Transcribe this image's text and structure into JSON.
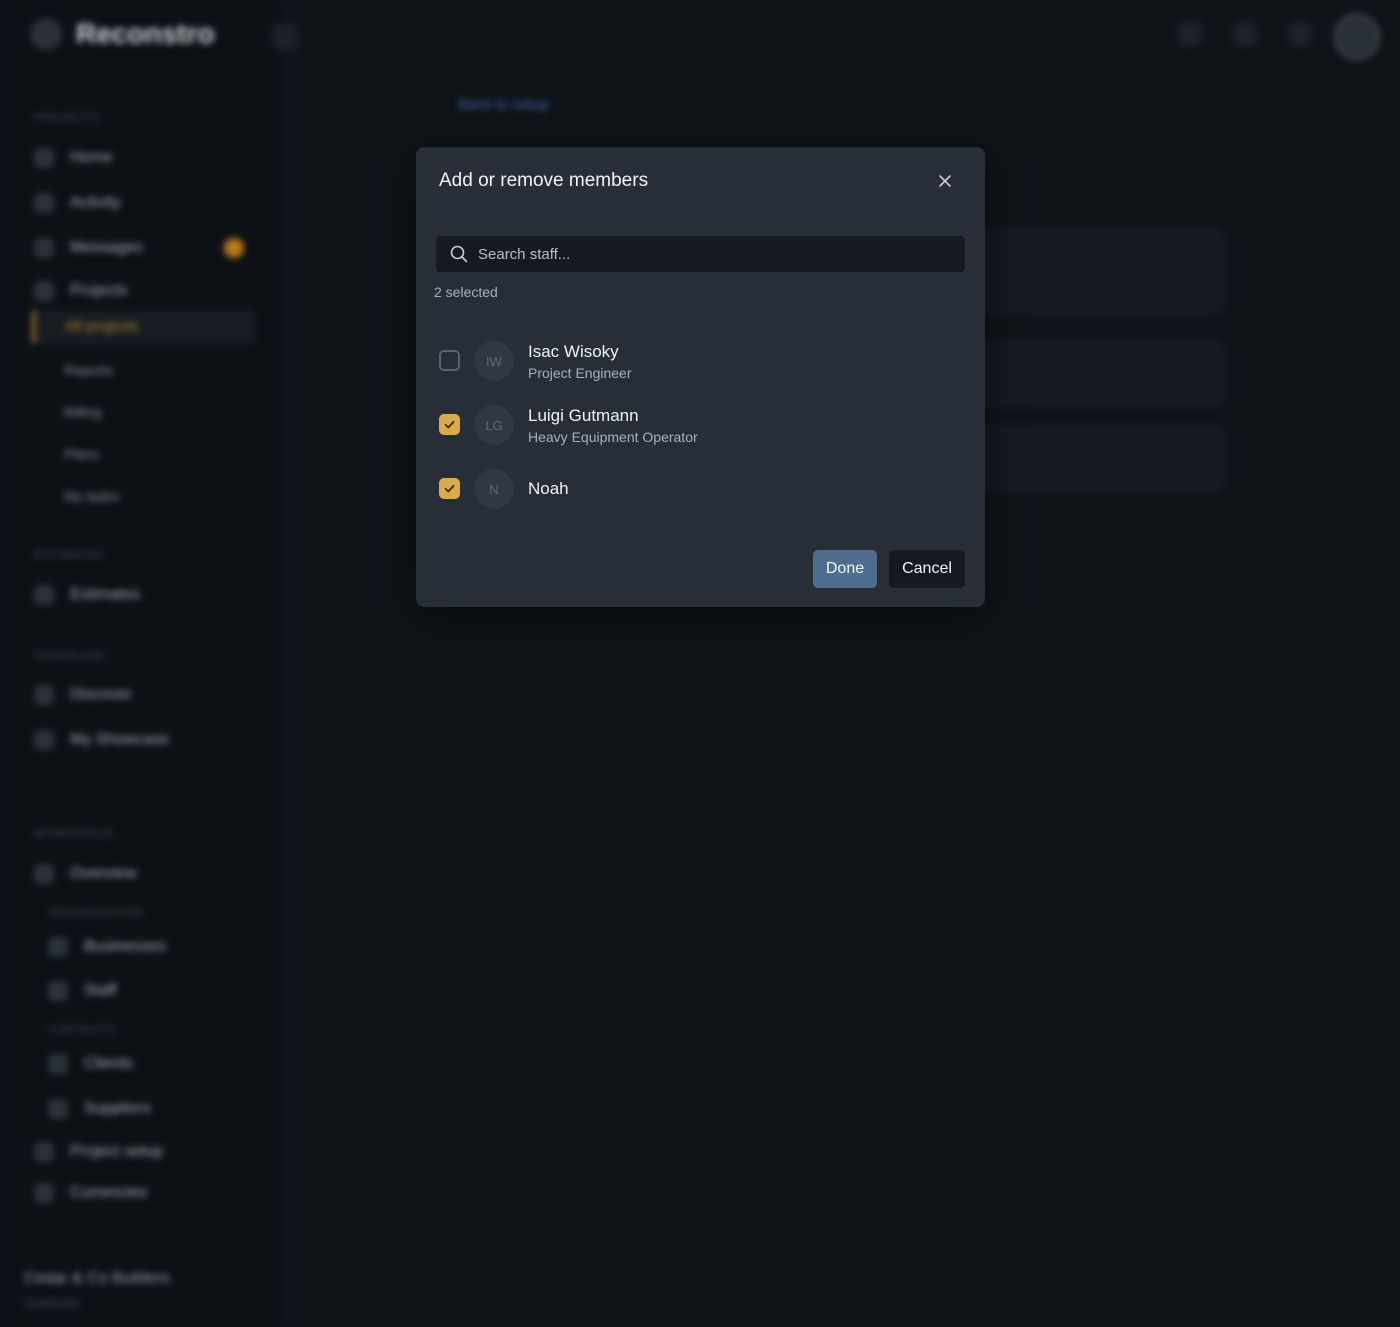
{
  "background": {
    "brand_name": "Reconstro",
    "sections": {
      "projects": "PROJECTS",
      "estimates": "ESTIMATES",
      "showcase": "SHOWCASE",
      "workspace": "WORKSPACE",
      "organization": "ORGANIZATION",
      "contacts": "CONTACTS"
    },
    "nav": {
      "home": "Home",
      "activity": "Activity",
      "messages": "Messages",
      "projects": "Projects",
      "all_projects": "All projects",
      "reports": "Reports",
      "billing": "Billing",
      "plans": "Plans",
      "my_tasks": "My tasks",
      "estimates": "Estimates",
      "discover": "Discover",
      "my_showcase": "My Showcase",
      "overview": "Overview",
      "businesses": "Businesses",
      "staff": "Staff",
      "clients": "Clients",
      "suppliers": "Suppliers",
      "project_setup": "Project setup",
      "currencies": "Currencies"
    },
    "org_name": "Cedar & Co Builders",
    "org_role": "Contractor",
    "back_link": "Back to setup"
  },
  "modal": {
    "title": "Add or remove members",
    "search_placeholder": "Search staff...",
    "selected_count": "2 selected",
    "members": [
      {
        "initials": "IW",
        "name": "Isac Wisoky",
        "role": "Project Engineer",
        "checked": false
      },
      {
        "initials": "LG",
        "name": "Luigi Gutmann",
        "role": "Heavy Equipment Operator",
        "checked": true
      },
      {
        "initials": "N",
        "name": "Noah",
        "role": "",
        "checked": true
      }
    ],
    "done_label": "Done",
    "cancel_label": "Cancel"
  },
  "colors": {
    "accent_checked": "#d9ac45",
    "done_button": "#4f6e8f",
    "modal_bg": "#272e38"
  }
}
